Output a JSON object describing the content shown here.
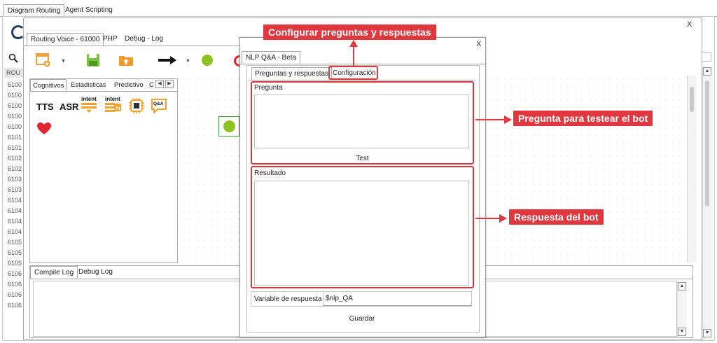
{
  "top_tabs": [
    "Diagram Routing",
    "Agent Scripting"
  ],
  "close_symbol": "X",
  "editor_tabs": [
    "Routing Voice - 61000",
    "PHP",
    "Debug - Log"
  ],
  "routing_header": "ROU",
  "line_numbers": [
    "6100",
    "6100",
    "6100",
    "6100",
    "6100",
    "6101",
    "6101",
    "6102",
    "6102",
    "6103",
    "6103",
    "6104",
    "6104",
    "6104",
    "6104",
    "6105",
    "6105",
    "6105",
    "6106",
    "6106",
    "6106",
    "6106"
  ],
  "palette_tabs": [
    "Cognitivos",
    "Estadisticas",
    "Predictivo",
    "C"
  ],
  "palette_items": [
    "TTS",
    "ASR",
    "intent",
    "intent",
    "Q&A"
  ],
  "log_tabs": [
    "Compile Log",
    "Debug Log"
  ],
  "dialog": {
    "title": "NLP Q&A - Beta",
    "tabs": [
      "Preguntas y respuestas",
      "Configuración"
    ],
    "question_label": "Pregunta",
    "test_label": "Test",
    "result_label": "Resultado",
    "variable_label": "Variable de respuesta",
    "variable_value": "$nlp_QA",
    "save_label": "Guardar"
  },
  "callouts": {
    "configure": "Configurar preguntas y respuestas",
    "question": "Pregunta para testear el bot",
    "answer": "Respuesta del bot"
  },
  "colors": {
    "annotation_red": "#e0383e",
    "green_node": "#8dc21f",
    "heart_red": "#e3262e",
    "intent_orange": "#f2a22a"
  }
}
